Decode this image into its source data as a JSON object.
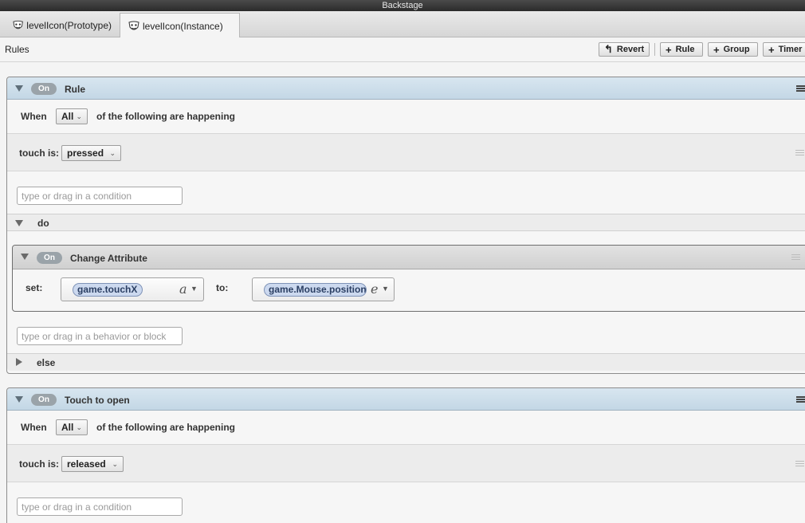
{
  "window": {
    "title": "Backstage"
  },
  "tabs": [
    {
      "label": "levelIcon(Prototype)",
      "active": false
    },
    {
      "label": "levelIcon(Instance)",
      "active": true
    }
  ],
  "toolbar": {
    "section_label": "Rules",
    "revert_label": "Revert",
    "rule_label": "Rule",
    "group_label": "Group",
    "timer_label": "Timer"
  },
  "rule1": {
    "toggle": "On",
    "name": "Rule",
    "when_label": "When",
    "when_value": "All",
    "when_suffix": "of the following are happening",
    "condition_label": "touch is:",
    "condition_value": "pressed",
    "condition_placeholder": "type or drag in a condition",
    "do_label": "do",
    "behavior": {
      "toggle": "On",
      "name": "Change Attribute",
      "set_label": "set:",
      "set_value": "game.touchX",
      "set_type_icon": "a",
      "to_label": "to:",
      "to_value": "game.Mouse.position",
      "to_type_icon": "e"
    },
    "behavior_placeholder": "type or drag in a behavior or block",
    "else_label": "else"
  },
  "rule2": {
    "toggle": "On",
    "name": "Touch to open",
    "when_label": "When",
    "when_value": "All",
    "when_suffix": "of the following are happening",
    "condition_label": "touch is:",
    "condition_value": "released",
    "condition_placeholder": "type or drag in a condition"
  },
  "colors": {
    "rule_header": "#c9dbe8",
    "chip_fill": "#ccd9ef",
    "on_pill": "#9aa3a9"
  }
}
